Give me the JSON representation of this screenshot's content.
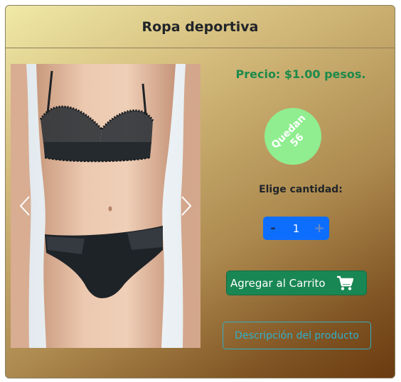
{
  "product": {
    "title": "Ropa deportiva",
    "price_label": "Precio: $1.00 pesos.",
    "stock": {
      "label": "Quedan",
      "count": "56"
    }
  },
  "quantity": {
    "label": "Elige cantidad:",
    "minus": "-",
    "value": "1",
    "plus": "+"
  },
  "actions": {
    "add_to_cart": "Agregar al Carrito",
    "description": "Descripción del producto"
  },
  "icons": {
    "carousel_prev": "chevron-left-icon",
    "carousel_next": "chevron-right-icon",
    "cart": "shopping-cart-icon"
  },
  "colors": {
    "price": "#1c8a4a",
    "stock_badge": "#90ee90",
    "stepper": "#0d6efd",
    "cart_button": "#198754",
    "description_button": "#2fb0c8"
  }
}
